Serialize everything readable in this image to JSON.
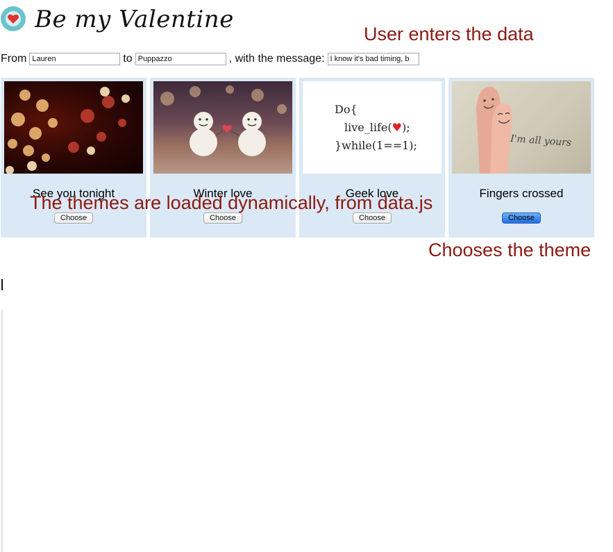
{
  "header": {
    "title": "Be my Valentine",
    "logo_icon": "heart-badge-icon"
  },
  "annotations": {
    "enters_data": "User enters the data",
    "themes_loaded": "The themes are loaded dynamically, from data.js",
    "chooses_theme": "Chooses the theme"
  },
  "form": {
    "from_label": "From",
    "from_value": "Lauren",
    "to_label": "to",
    "to_value": "Puppazzo",
    "message_label": ", with the message:",
    "message_value": "I know it's bad timing, b"
  },
  "themes": [
    {
      "name": "See you tonight",
      "button": "Choose",
      "selected": false,
      "image": "bokeh-hearts"
    },
    {
      "name": "Winter love",
      "button": "Choose",
      "selected": false,
      "image": "snowmen-heart"
    },
    {
      "name": "Geek love",
      "button": "Choose",
      "selected": false,
      "image": "code-snippet"
    },
    {
      "name": "Fingers crossed",
      "button": "Choose",
      "selected": true,
      "image": "finger-faces"
    }
  ],
  "geek_image": {
    "line1": "Do{",
    "line2": "live_life(",
    "line2_end": ");",
    "line3": "}while(1==1);"
  },
  "finger_image": {
    "caption": "I'm all yours"
  },
  "colors": {
    "annotation": "#8b1a12",
    "card_bg": "#dbe8f5",
    "selected_button": "#1f6fe6"
  }
}
